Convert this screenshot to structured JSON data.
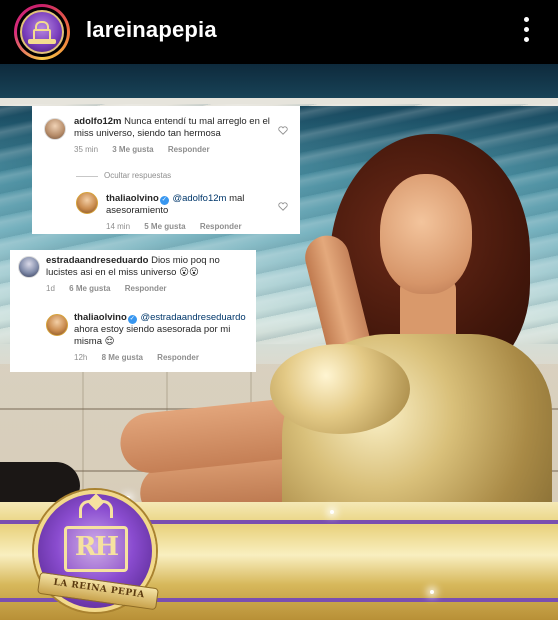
{
  "header": {
    "username": "lareinapepia",
    "avatar_icon": "la-reina-pepia-logo",
    "more_icon": "more-vertical-icon"
  },
  "comments": {
    "thread1": {
      "user": "adolfo12m",
      "text": "Nunca entendí tu mal arreglo en el miss universo, siendo tan hermosa",
      "time": "35 min",
      "likes": "3 Me gusta",
      "reply": "Responder",
      "hide_replies": "Ocultar respuestas",
      "reply_comment": {
        "user": "thaliaolvino",
        "mention": "@adolfo12m",
        "text": "mal asesoramiento",
        "time": "14 min",
        "likes": "5 Me gusta",
        "reply": "Responder"
      }
    },
    "thread2": {
      "user": "estradaandreseduardo",
      "text": "Dios mio poq no lucistes asi en el miss universo",
      "emoji": "😮😮",
      "time": "1d",
      "likes": "6 Me gusta",
      "reply": "Responder",
      "reply_comment": {
        "user": "thaliaolvino",
        "mention": "@estradaandreseduardo",
        "text": "ahora estoy siendo asesorada por mi misma",
        "emoji": "😌",
        "time": "12h",
        "likes": "8 Me gusta",
        "reply": "Responder"
      }
    }
  },
  "logo": {
    "monogram": "RH",
    "ribbon_text": "LA REINA PEPIA"
  },
  "colors": {
    "verified": "#3897f0",
    "meta_text": "#8e8e8e",
    "brand_purple": "#7a4fb0",
    "brand_gold": "#e9d27e"
  }
}
